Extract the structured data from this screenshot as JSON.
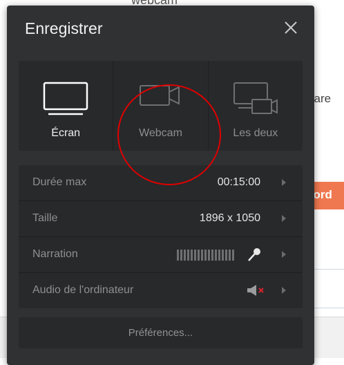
{
  "background": {
    "top_text": "webcam",
    "side_text": "vare",
    "orange_button_text": "cord"
  },
  "dialog": {
    "title": "Enregistrer",
    "modes": [
      {
        "label": "Écran",
        "icon": "monitor-icon",
        "selected": true
      },
      {
        "label": "Webcam",
        "icon": "webcam-icon",
        "selected": false
      },
      {
        "label": "Les deux",
        "icon": "screen-and-webcam-icon",
        "selected": false
      }
    ],
    "settings": {
      "duration": {
        "label": "Durée max",
        "value": "00:15:00"
      },
      "size": {
        "label": "Taille",
        "value": "1896 x 1050"
      },
      "narration": {
        "label": "Narration",
        "icon": "microphone-icon"
      },
      "computer_audio": {
        "label": "Audio de l'ordinateur",
        "icon": "speaker-muted-icon"
      }
    },
    "preferences_label": "Préférences..."
  },
  "colors": {
    "dialog_bg": "#303133",
    "panel_bg": "#28292b",
    "annotation": "#e00000",
    "mute_x": "#d9232d",
    "orange": "#f07850"
  }
}
